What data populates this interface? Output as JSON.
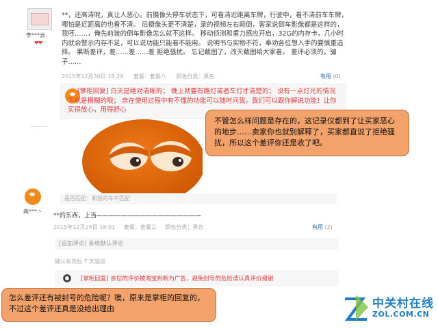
{
  "review1": {
    "user": "李***云",
    "badge": "❤❤",
    "body": "**，还高清呢，真让人恶心。前摄像头停车状态下，可看清近距离车牌，行驶中，看不清前车车牌，哪怕是近距离的也看不清。 后摄像头更不清楚，录的视频左右颠倒，客家说倒车影像都是这样的，我呸……，俺先前装的倒车影像怎么就不这样。 移动侦测和重力感应开启，32G的内存卡，几小时内就会警示内存不足，可以说功能只能看不能用。 说明书与实物不符，奉劝各位想入手的要慎重选择。 果断差评，差……差……差 拒绝骚扰。 忘记截图了，改天截图给大家看。 差评必须的，骗子……",
    "date": "2015年12月30日 18:29",
    "package": "套餐：套餐八",
    "color": "颜色分类：黑色",
    "useful_label": "有用",
    "useful_count": "(0)",
    "reply": "[掌柜回复] 白天是绝对清晰的； 晚上就要有路灯或者车灯才清楚的； 没有一点灯光的情况下就是模糊的哦； 亲在使用过程中有不懂的功能可以随时问我，我们可以跟你解说功能！让你买得放心，用得舒心"
  },
  "callout1": "不管怎么样问题是存在的，这记录仪都到了让买家恶心的地步……卖家你也就别解释了，买家都直说了拒绝骚扰，所以这个差评你还是收了吧。",
  "review2": {
    "user": "高***丶",
    "tag": "是否匹配：和我的车不匹配",
    "body": "**的东西，上当—————————————————",
    "date": "2015年12月24日 18:01",
    "package": "套餐：套餐三",
    "color": "颜色分类：黑色",
    "useful_label": "有用",
    "useful_count": "(2)",
    "additional_heading": "[追加评论] 系统默认评论",
    "additional_when": "确认收货后 7 天追加",
    "reply": "[掌柜回复] 亲您的评价被淘宝判断为广告，避免封号的危险请认真评价谢谢"
  },
  "callout2": "怎么差评还有被封号的危险呢？噢，原来是掌柜的回复的，不过这个差评还真是没给出理由",
  "watermark": {
    "zh": "中关村在线",
    "en": "ZOL.COM.CN"
  },
  "colors": {
    "callout_fill": "#f2a26a",
    "reply_red": "#e4393c",
    "useful_blue": "#2a6fb5",
    "brand_blue": "#1e7cc8"
  }
}
